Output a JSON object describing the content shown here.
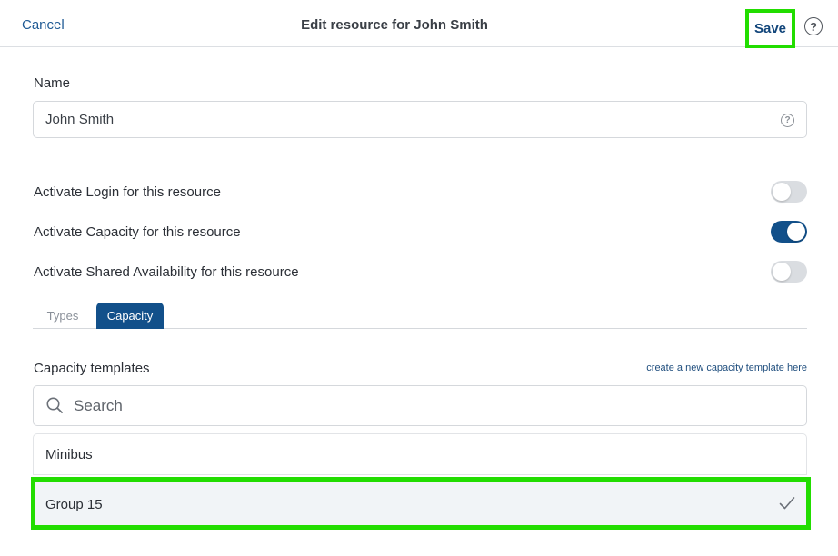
{
  "header": {
    "cancel_label": "Cancel",
    "title": "Edit resource for John Smith",
    "save_label": "Save",
    "help_glyph": "?"
  },
  "form": {
    "name_label": "Name",
    "name_value": "John Smith",
    "name_help_glyph": "?"
  },
  "toggles": [
    {
      "label": "Activate Login for this resource",
      "state": "off"
    },
    {
      "label": "Activate Capacity for this resource",
      "state": "on"
    },
    {
      "label": "Activate Shared Availability for this resource",
      "state": "off"
    }
  ],
  "tabs": [
    {
      "label": "Types",
      "active": false
    },
    {
      "label": "Capacity",
      "active": true
    }
  ],
  "capacity": {
    "section_label": "Capacity templates",
    "create_link": "create a new capacity template here",
    "search_placeholder": "Search",
    "items": [
      {
        "label": "Minibus",
        "selected": false
      },
      {
        "label": "Group 15",
        "selected": true
      }
    ]
  },
  "colors": {
    "accent": "#12508a",
    "highlight": "#22dd00",
    "link": "#1f5a94"
  },
  "icons": {
    "search": "search-icon",
    "check": "check-icon",
    "help": "help-icon"
  }
}
